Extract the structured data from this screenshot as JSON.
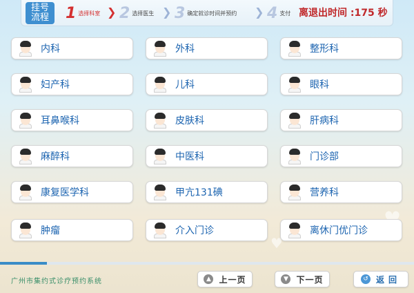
{
  "header": {
    "flow_label": "挂号\n流程",
    "steps": [
      {
        "num": "1",
        "label": "选择科室",
        "active": true
      },
      {
        "num": "2",
        "label": "选择医生",
        "active": false
      },
      {
        "num": "3",
        "label": "确定就诊时间并预约",
        "active": false
      },
      {
        "num": "4",
        "label": "支付",
        "active": false
      }
    ],
    "countdown_prefix": "离退出时间 :",
    "countdown_value": "175",
    "countdown_unit": " 秒"
  },
  "departments": [
    "内科",
    "外科",
    "整形科",
    "妇产科",
    "儿科",
    "眼科",
    "耳鼻喉科",
    "皮肤科",
    "肝病科",
    "麻醉科",
    "中医科",
    "门诊部",
    "康复医学科",
    "甲亢131碘",
    "营养科",
    "肿瘤",
    "介入门诊",
    "离休门优门诊"
  ],
  "progress": {
    "fraction": 0.113
  },
  "footer": {
    "system_title": "广州市集约式诊疗预约系统",
    "prev_label": "上一页",
    "next_label": "下一页",
    "back_label": "返回"
  },
  "colors": {
    "accent": "#3f8fd0",
    "active_step": "#d43030",
    "department_text": "#1c64b0"
  },
  "icons": {
    "department": "doctor-avatar-icon",
    "prev": "arrow-up-icon",
    "next": "arrow-down-icon",
    "back": "back-arrow-icon"
  }
}
